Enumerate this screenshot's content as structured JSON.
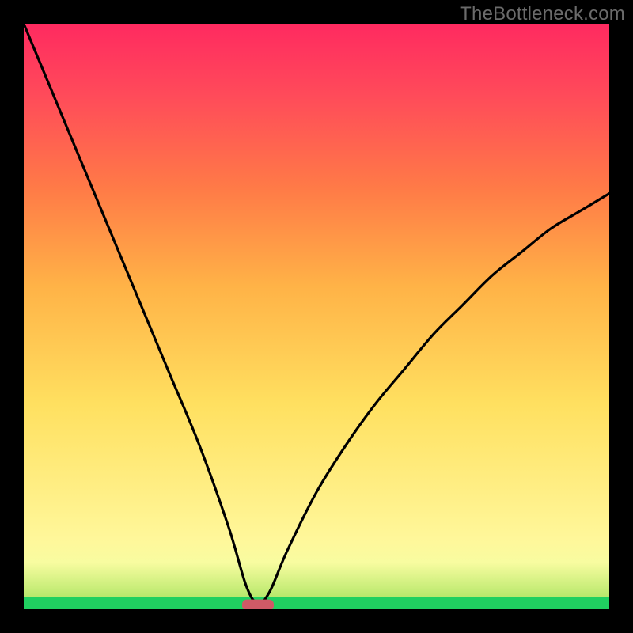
{
  "watermark": {
    "text": "TheBottleneck.com"
  },
  "chart_data": {
    "type": "line",
    "title": "",
    "xlabel": "",
    "ylabel": "",
    "xlim": [
      0,
      100
    ],
    "ylim": [
      0,
      100
    ],
    "grid": false,
    "legend": false,
    "notes": "Bottleneck-style V curve on red→green vertical gradient; minimum near x≈40. Values estimated from pixel heights; no axis ticks are visible.",
    "series": [
      {
        "name": "curve",
        "x": [
          0,
          5,
          10,
          15,
          20,
          25,
          30,
          35,
          38,
          40,
          42,
          45,
          50,
          55,
          60,
          65,
          70,
          75,
          80,
          85,
          90,
          95,
          100
        ],
        "y": [
          100,
          88,
          76,
          64,
          52,
          40,
          28,
          14,
          4,
          1,
          3,
          10,
          20,
          28,
          35,
          41,
          47,
          52,
          57,
          61,
          65,
          68,
          71
        ]
      }
    ],
    "marker": {
      "x": 40,
      "y": 1,
      "color": "#d05a66",
      "shape": "rounded-rect"
    }
  }
}
